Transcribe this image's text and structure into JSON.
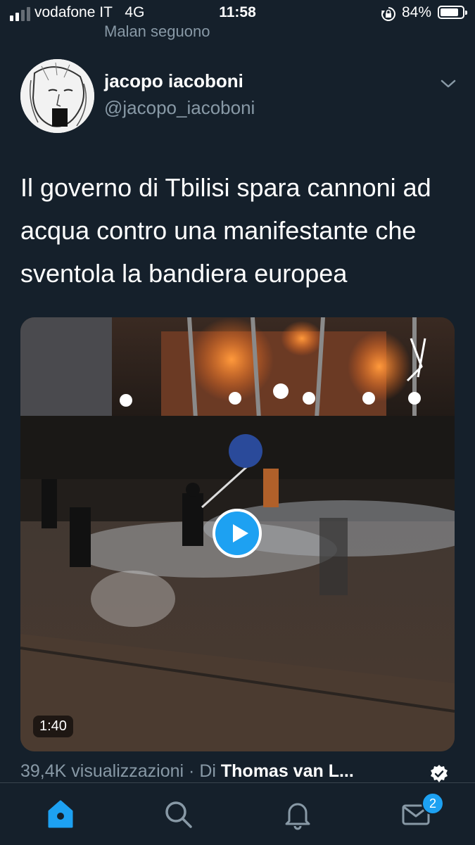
{
  "status_bar": {
    "carrier": "vodafone IT",
    "network": "4G",
    "time": "11:58",
    "battery": "84%",
    "battery_level": 0.84,
    "signal_bars": 2
  },
  "social_context": "Malan seguono",
  "tweet": {
    "author": {
      "display_name": "jacopo iacoboni",
      "handle": "@jacopo_iacoboni"
    },
    "text": "Il governo di Tbilisi spara cannoni ad acqua contro una manifestante che sventola la bandiera europea",
    "video": {
      "duration": "1:40",
      "play_icon": "play-icon"
    },
    "views": "39,4K visualizzazioni",
    "separator": "·",
    "by_label": "Di",
    "video_author": "Thomas van L...",
    "verified_icon": "verified-badge-icon"
  },
  "tab_bar": {
    "items": [
      "home-icon",
      "search-icon",
      "bell-icon",
      "mail-icon"
    ],
    "messages_badge": "2"
  },
  "colors": {
    "background": "#15202b",
    "accent": "#1da1f2",
    "secondary_text": "#8899a6"
  }
}
